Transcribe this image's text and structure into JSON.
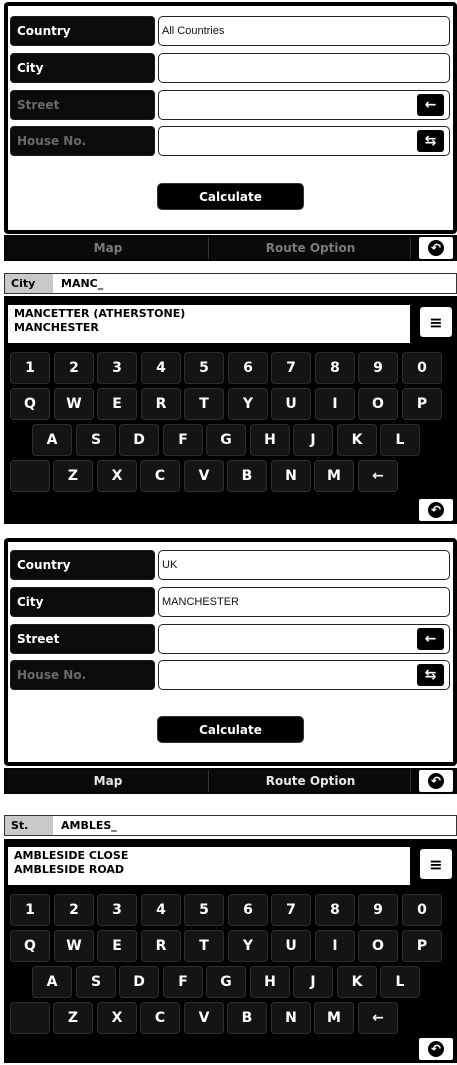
{
  "screen1": {
    "fields": [
      {
        "label": "Country",
        "value": "All Countries",
        "dim": false
      },
      {
        "label": "City",
        "value": "",
        "dim": false
      },
      {
        "label": "Street",
        "value": "",
        "dim": true
      },
      {
        "label": "House No.",
        "value": "",
        "dim": true
      }
    ],
    "street_button": "←",
    "house_button": "⇆",
    "calculate_label": "Calculate",
    "nav": {
      "map_label": "Map",
      "route_label": "Route Option",
      "map_active": false,
      "route_active": false
    }
  },
  "screen2": {
    "input_prefix": "City",
    "input_value": "MANC_",
    "suggestions": [
      "MANCETTER (ATHERSTONE)",
      "MANCHESTER"
    ],
    "scroll_icon": "▼"
  },
  "screen3": {
    "fields": [
      {
        "label": "Country",
        "value": "UK",
        "dim": false
      },
      {
        "label": "City",
        "value": "MANCHESTER",
        "dim": false
      },
      {
        "label": "Street",
        "value": "",
        "dim": false
      },
      {
        "label": "House No.",
        "value": "",
        "dim": true
      }
    ],
    "street_button": "←",
    "house_button": "⇆",
    "calculate_label": "Calculate",
    "nav": {
      "map_label": "Map",
      "route_label": "Route Option",
      "map_active": true,
      "route_active": true
    }
  },
  "screen4": {
    "input_prefix": "St.",
    "input_value": "AMBLES_",
    "suggestions": [
      "AMBLESIDE CLOSE",
      "AMBLESIDE ROAD"
    ],
    "scroll_icon": "▼"
  },
  "keyboard": {
    "row_numbers": [
      "1",
      "2",
      "3",
      "4",
      "5",
      "6",
      "7",
      "8",
      "9",
      "0"
    ],
    "row_q": [
      "Q",
      "W",
      "E",
      "R",
      "T",
      "Y",
      "U",
      "I",
      "O",
      "P"
    ],
    "row_a": [
      "A",
      "S",
      "D",
      "F",
      "G",
      "H",
      "J",
      "K",
      "L"
    ],
    "row_z": [
      "Z",
      "X",
      "C",
      "V",
      "B",
      "N",
      "M",
      "←"
    ]
  },
  "icons": {
    "back": "back-arrow-icon",
    "backspace": "backspace-icon",
    "scroll": "scroll-down-icon",
    "swap": "swap-icon"
  },
  "colors": {
    "panel": "#000000",
    "label_bg": "#0b0b0b",
    "field_bg": "#ffffff",
    "prefix_bg": "#c9c9c9",
    "dim_text": "#6a6a6a"
  }
}
